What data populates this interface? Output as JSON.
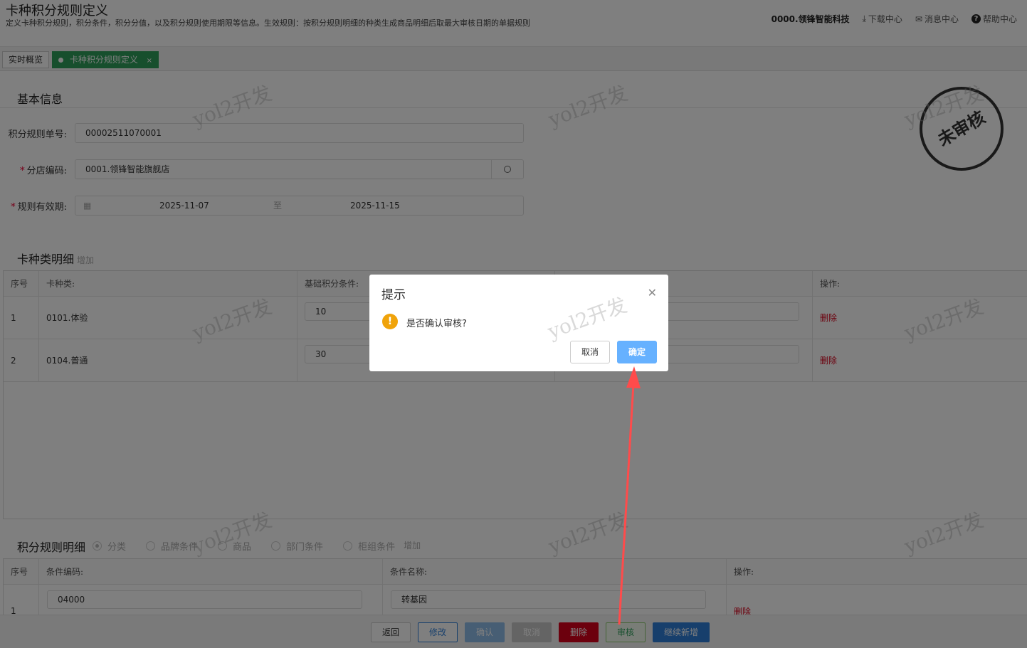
{
  "header": {
    "title": "卡种积分规则定义",
    "description": "定义卡种积分规则，积分条件，积分分值，以及积分规则使用期限等信息。生效规则：按积分规则明细的种类生成商品明细后取最大审核日期的单据规则",
    "company": "0000.领锋智能科技",
    "links": {
      "download": "下载中心",
      "messages": "消息中心",
      "help": "帮助中心"
    }
  },
  "tabs": [
    {
      "label": "实时概览"
    },
    {
      "label": "卡种积分规则定义",
      "close": "×"
    }
  ],
  "basic_info": {
    "section_title": "基本信息",
    "rule_no_label": "积分规则单号:",
    "rule_no_value": "00002511070001",
    "branch_label": "分店编码:",
    "branch_value": "0001.领锋智能旗舰店",
    "period_label": "规则有效期:",
    "period_start": "2025-11-07",
    "period_sep": "至",
    "period_end": "2025-11-15"
  },
  "stamp": {
    "text": "未审核"
  },
  "card_detail": {
    "section_title": "卡种类明细",
    "add_label": "增加",
    "headers": {
      "seq": "序号",
      "card_type": "卡种类:",
      "base_points": "基础积分条件:",
      "ops": "操作:"
    },
    "rows": [
      {
        "seq": "1",
        "card_type": "0101.体验",
        "base_points": "10",
        "delete": "删除"
      },
      {
        "seq": "2",
        "card_type": "0104.普通",
        "base_points": "30",
        "delete": "删除"
      }
    ]
  },
  "points_detail": {
    "section_title": "积分规则明细",
    "options": [
      "分类",
      "品牌条件",
      "商品",
      "部门条件",
      "柜组条件"
    ],
    "selected_option": "分类",
    "add_label": "增加",
    "headers": {
      "seq": "序号",
      "code": "条件编码:",
      "name": "条件名称:",
      "ops": "操作:"
    },
    "rows": [
      {
        "seq": "1",
        "code": "04000",
        "name": "转基因",
        "delete": "删除"
      }
    ]
  },
  "footer_buttons": {
    "back": "返回",
    "edit": "修改",
    "confirm": "确认",
    "cancel": "取消",
    "delete": "删除",
    "audit": "审核",
    "continue_add": "继续新增"
  },
  "watermark": {
    "text": "yol2开发"
  },
  "dialog": {
    "title": "提示",
    "message": "是否确认审核?",
    "cancel": "取消",
    "ok": "确定"
  },
  "colors": {
    "accent_green": "#2e9e5b",
    "primary_blue": "#2f7fd8",
    "danger_red": "#d9001b",
    "warning_orange": "#f0a30a",
    "annotation_red": "#ff4b4b"
  }
}
